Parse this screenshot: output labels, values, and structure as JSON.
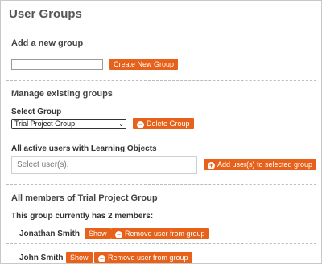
{
  "page": {
    "title": "User Groups"
  },
  "add_group": {
    "heading": "Add a new group",
    "name_input_value": "",
    "create_button": "Create New Group"
  },
  "manage": {
    "heading": "Manage existing groups",
    "select_label": "Select Group",
    "selected_group": "Trial Project Group",
    "delete_button": "Delete Group",
    "active_users_label": "All active users with Learning Objects",
    "user_select_placeholder": "Select user(s).",
    "add_users_button": "Add user(s) to selected group"
  },
  "members": {
    "heading": "All members of Trial Project Group",
    "count_text": "This group currently has 2 members:",
    "list": [
      {
        "name": "Jonathan Smith",
        "show_button": "Show",
        "remove_button": "Remove user from group"
      },
      {
        "name": "John Smith",
        "show_button": "Show",
        "remove_button": "Remove user from group"
      }
    ]
  },
  "theme": {
    "accent": "#e8611a",
    "divider": "#bdbdbd"
  }
}
